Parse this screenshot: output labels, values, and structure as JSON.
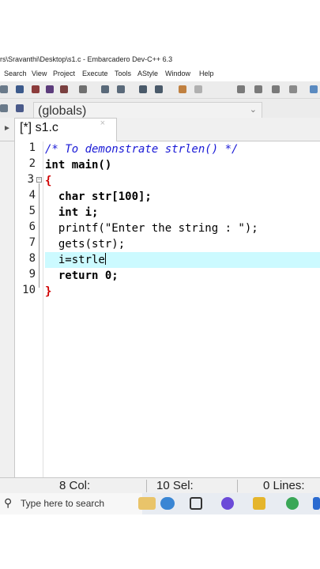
{
  "window": {
    "title": "rs\\Sravanthi\\Desktop\\s1.c - Embarcadero Dev-C++ 6.3"
  },
  "menu": [
    "Search",
    "View",
    "Project",
    "Execute",
    "Tools",
    "AStyle",
    "Window",
    "Help"
  ],
  "scope": {
    "value": "(globals)"
  },
  "tab": {
    "label": "[*] s1.c",
    "close": "×"
  },
  "code_lines": [
    {
      "n": "1",
      "text": "/* To demonstrate strlen() */"
    },
    {
      "n": "2",
      "text": "int main()"
    },
    {
      "n": "3",
      "text": "{"
    },
    {
      "n": "4",
      "text": "  char str[100];"
    },
    {
      "n": "5",
      "text": "  int i;"
    },
    {
      "n": "6",
      "text": "  printf(\"Enter the string : \");"
    },
    {
      "n": "7",
      "text": "  gets(str);"
    },
    {
      "n": "8",
      "text": "  i=strle"
    },
    {
      "n": "9",
      "text": "  return 0;"
    },
    {
      "n": "10",
      "text": "}"
    }
  ],
  "highlighted_line": "8",
  "status": {
    "col": "8 Col:",
    "sel": "10 Sel:",
    "lines": "0 Lines:"
  },
  "taskbar": {
    "search_placeholder": "Type here to search"
  },
  "colors": {
    "highlight": "#ccfaff",
    "comment": "#1a1ad6",
    "number": "#9a2be2",
    "brace": "#d00000"
  }
}
